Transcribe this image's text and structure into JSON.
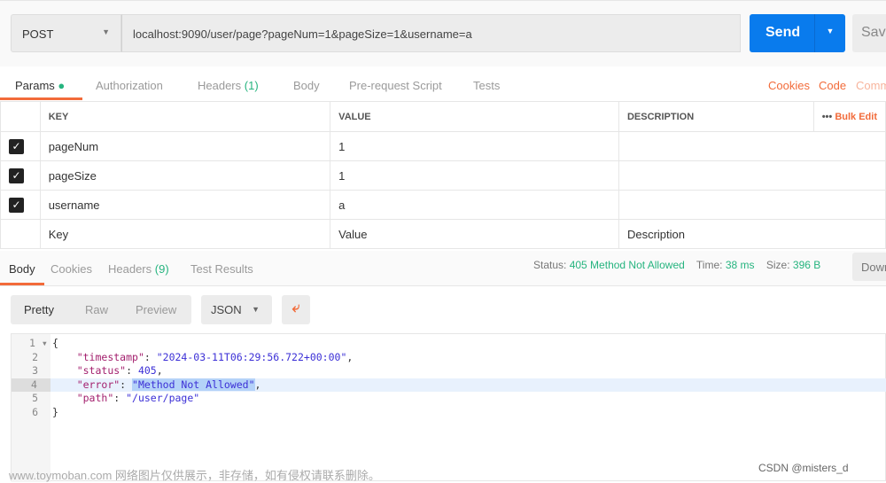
{
  "request": {
    "method": "POST",
    "url": "localhost:9090/user/page?pageNum=1&pageSize=1&username=a",
    "send_label": "Send",
    "save_label": "Save"
  },
  "req_tabs": {
    "params": "Params",
    "authorization": "Authorization",
    "headers": "Headers",
    "headers_count": "(1)",
    "body": "Body",
    "prerequest": "Pre-request Script",
    "tests": "Tests",
    "cookies": "Cookies",
    "code": "Code",
    "comments": "Comments"
  },
  "params_table": {
    "headers": {
      "key": "KEY",
      "value": "VALUE",
      "description": "DESCRIPTION",
      "more": "•••",
      "bulk": "Bulk Edit"
    },
    "rows": [
      {
        "key": "pageNum",
        "value": "1",
        "checked": true
      },
      {
        "key": "pageSize",
        "value": "1",
        "checked": true
      },
      {
        "key": "username",
        "value": "a",
        "checked": true
      }
    ],
    "placeholder": {
      "key": "Key",
      "value": "Value",
      "description": "Description"
    }
  },
  "resp_tabs": {
    "body": "Body",
    "cookies": "Cookies",
    "headers": "Headers",
    "headers_count": "(9)",
    "test_results": "Test Results"
  },
  "status": {
    "status_label": "Status:",
    "status_value": "405 Method Not Allowed",
    "time_label": "Time:",
    "time_value": "38 ms",
    "size_label": "Size:",
    "size_value": "396 B",
    "download": "Download"
  },
  "view": {
    "pretty": "Pretty",
    "raw": "Raw",
    "preview": "Preview",
    "format": "JSON"
  },
  "code": {
    "lines": [
      {
        "n": "1",
        "parts": [
          [
            "p",
            "{"
          ]
        ]
      },
      {
        "n": "2",
        "parts": [
          [
            "p",
            "    "
          ],
          [
            "k",
            "\"timestamp\""
          ],
          [
            "p",
            ": "
          ],
          [
            "s",
            "\"2024-03-11T06:29:56.722+00:00\""
          ],
          [
            "p",
            ","
          ]
        ]
      },
      {
        "n": "3",
        "parts": [
          [
            "p",
            "    "
          ],
          [
            "k",
            "\"status\""
          ],
          [
            "p",
            ": "
          ],
          [
            "n",
            "405"
          ],
          [
            "p",
            ","
          ]
        ]
      },
      {
        "n": "4",
        "parts": [
          [
            "p",
            "    "
          ],
          [
            "k",
            "\"error\""
          ],
          [
            "p",
            ": "
          ],
          [
            "sel",
            "\"Method Not Allowed\""
          ],
          [
            "p",
            ","
          ]
        ]
      },
      {
        "n": "5",
        "parts": [
          [
            "p",
            "    "
          ],
          [
            "k",
            "\"path\""
          ],
          [
            "p",
            ": "
          ],
          [
            "s",
            "\"/user/page\""
          ]
        ]
      },
      {
        "n": "6",
        "parts": [
          [
            "p",
            "}"
          ]
        ]
      }
    ]
  },
  "watermark": {
    "left": "www.toymoban.com 网络图片仅供展示，非存储，如有侵权请联系删除。",
    "right": "CSDN @misters_d"
  },
  "colors": {
    "accent": "#f26b3a",
    "send": "#097bed",
    "green": "#26b47f"
  }
}
